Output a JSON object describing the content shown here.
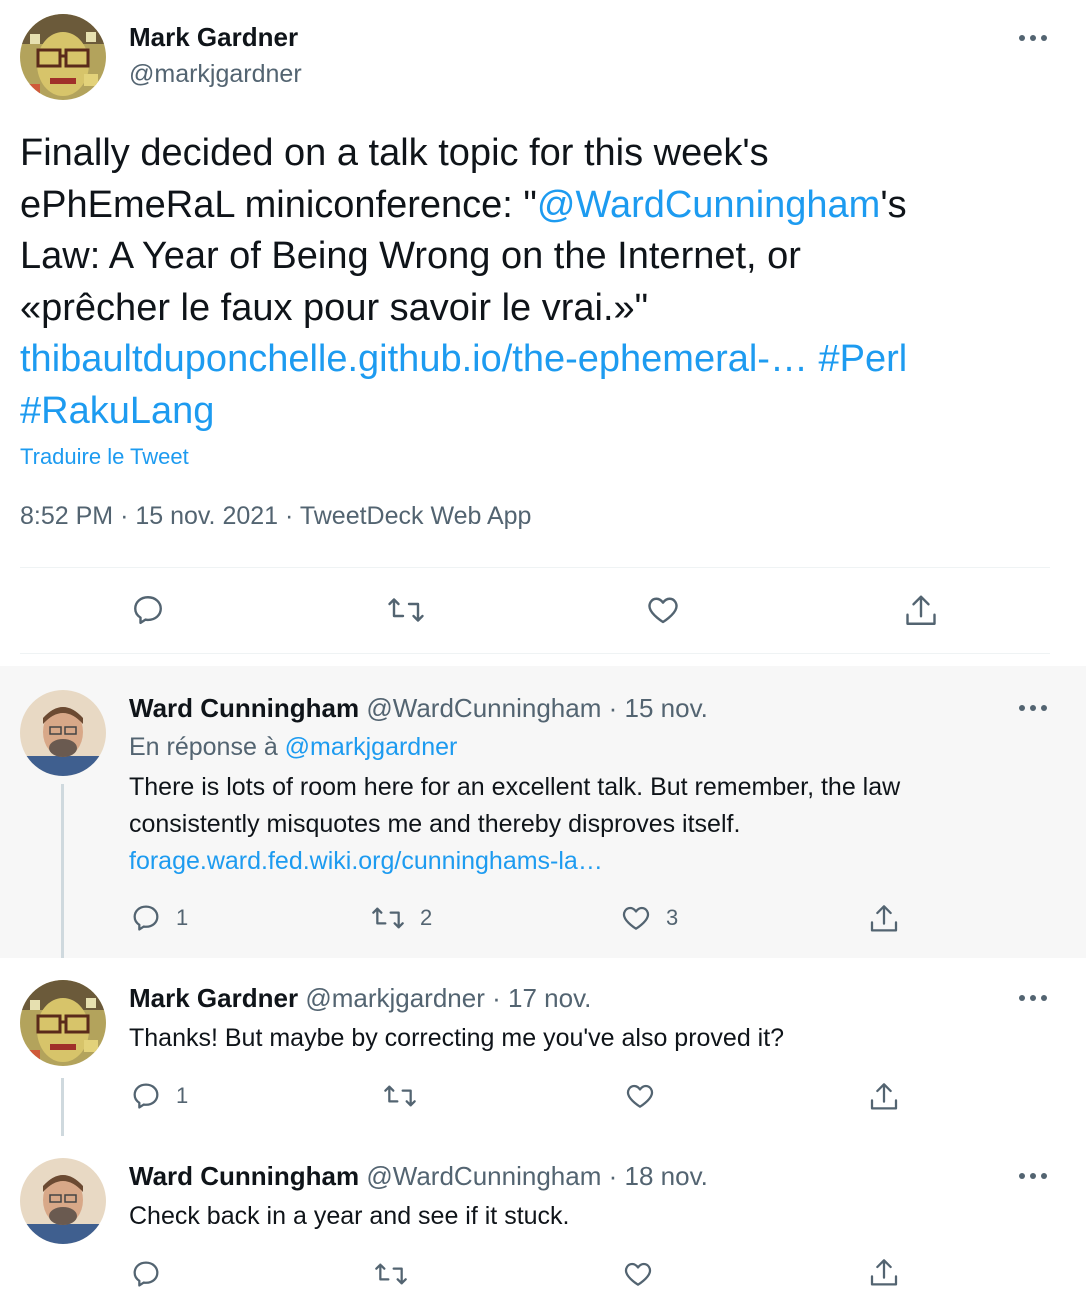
{
  "main_tweet": {
    "author_name": "Mark Gardner",
    "author_handle": "@markjgardner",
    "text": {
      "line1": "Finally decided on a talk topic for this week's",
      "line2_a": "ePhEmeRaL miniconference: \"",
      "line2_mention": "@WardCunningham",
      "line2_b": "'s",
      "line3": "Law: A Year of Being Wrong on the Internet, or",
      "line4": "«prêcher le faux pour savoir le vrai.»\"",
      "line5_link": "thibaultduponchelle.github.io/the-ephemeral-…",
      "line5_tag": "#Perl",
      "line6_tag": "#RakuLang"
    },
    "translate_label": "Traduire le Tweet",
    "time": "8:52 PM",
    "date": "15 nov. 2021",
    "source": "TweetDeck Web App",
    "sep": "·"
  },
  "replies": [
    {
      "author_name": "Ward Cunningham",
      "author_handle": "@WardCunningham",
      "date": "15 nov.",
      "reply_to_prefix": "En réponse à",
      "reply_to_handle": "@markjgardner",
      "text_line1": "There is lots of room here for an excellent talk. But remember, the law",
      "text_line2": "consistently misquotes me and thereby disproves itself.",
      "link": "forage.ward.fed.wiki.org/cunninghams-la…",
      "reply_count": "1",
      "retweet_count": "2",
      "like_count": "3"
    },
    {
      "author_name": "Mark Gardner",
      "author_handle": "@markjgardner",
      "date": "17 nov.",
      "text_line1": "Thanks! But maybe by correcting me you've also proved it?",
      "reply_count": "1",
      "retweet_count": "",
      "like_count": ""
    },
    {
      "author_name": "Ward Cunningham",
      "author_handle": "@WardCunningham",
      "date": "18 nov.",
      "text_line1": "Check back in a year and see if it stuck.",
      "reply_count": "",
      "retweet_count": "",
      "like_count": ""
    }
  ],
  "sep": "·",
  "colors": {
    "link": "#1d9bf0",
    "muted": "#536471",
    "text": "#0f1419",
    "reply_bg": "#f7f7f7"
  }
}
